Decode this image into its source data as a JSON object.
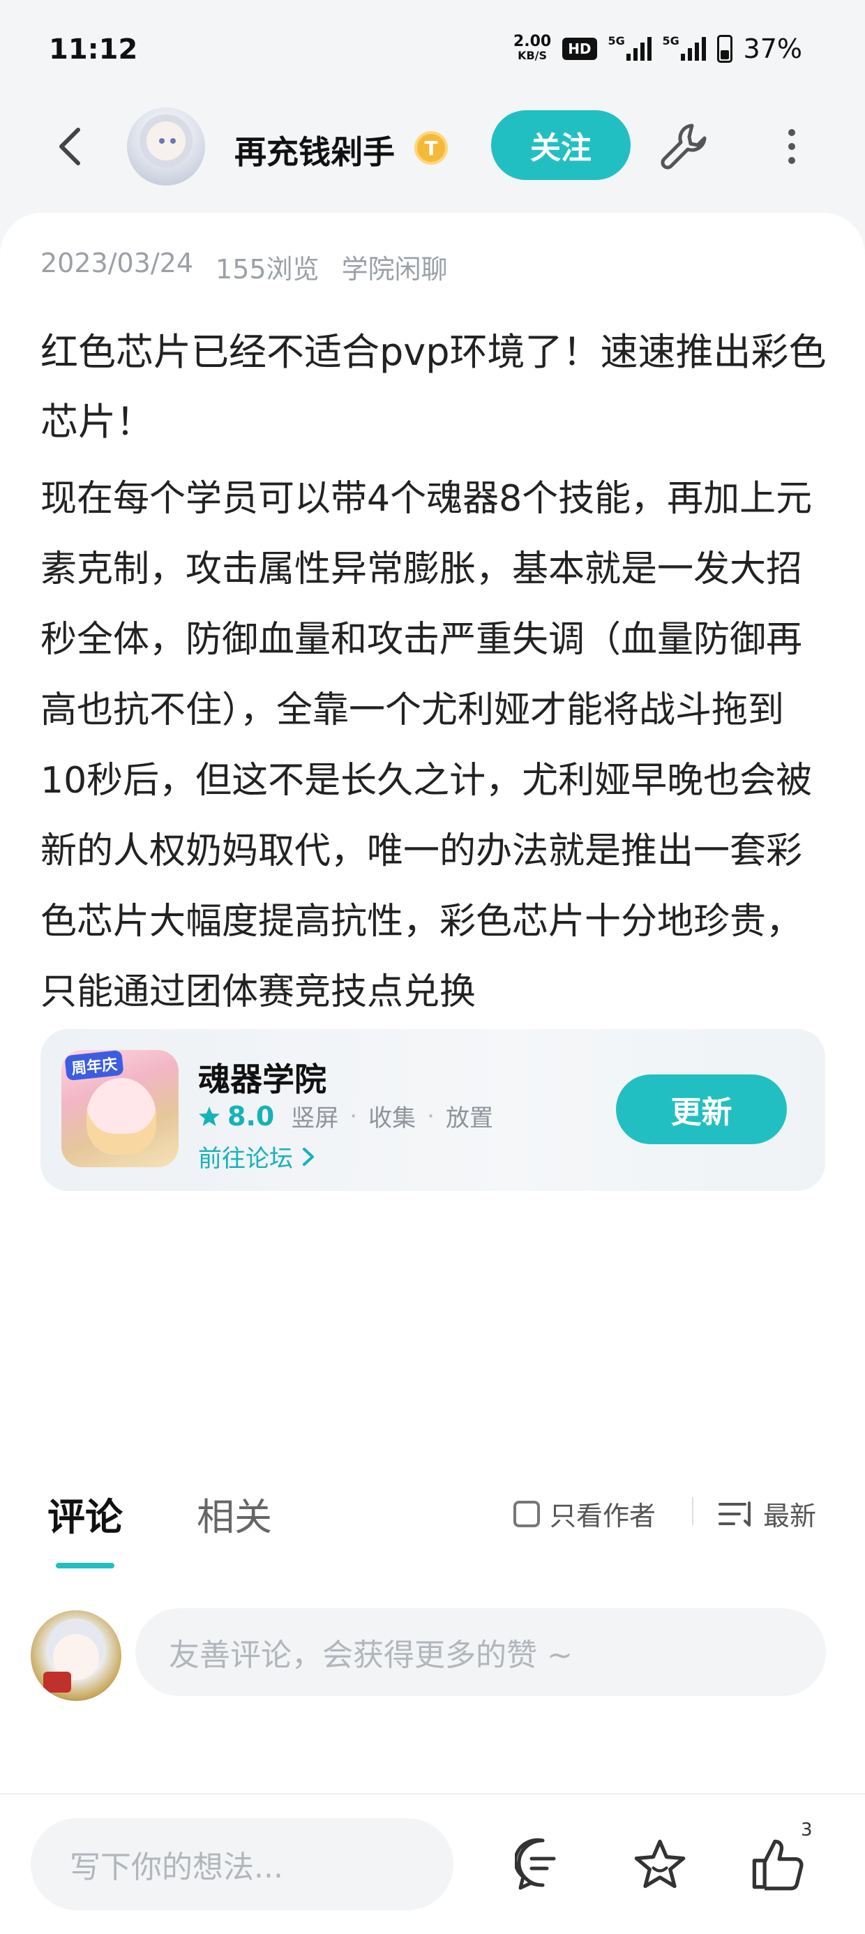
{
  "status_bar": {
    "time": "11:12",
    "net_speed_value": "2.00",
    "net_speed_unit": "KB/S",
    "hd_label": "HD",
    "signal1_tag": "5G",
    "signal2_tag": "5G",
    "battery": "37%"
  },
  "header": {
    "author_name": "再充钱剁手",
    "badge_letter": "T",
    "follow_label": "关注"
  },
  "post": {
    "date": "2023/03/24",
    "views": "155浏览",
    "category": "学院闲聊",
    "title": "红色芯片已经不适合pvp环境了！速速推出彩色芯片！",
    "body": "现在每个学员可以带4个魂器8个技能，再加上元素克制，攻击属性异常膨胀，基本就是一发大招秒全体，防御血量和攻击严重失调（血量防御再高也抗不住），全靠一个尤利娅才能将战斗拖到10秒后，但这不是长久之计，尤利娅早晚也会被新的人权奶妈取代，唯一的办法就是推出一套彩色芯片大幅度提高抗性，彩色芯片十分地珍贵，只能通过团体赛竞技点兑换",
    "like_count": "3"
  },
  "app_card": {
    "icon_tag": "周年庆",
    "name": "魂器学院",
    "rating": "8.0",
    "tags": [
      "竖屏",
      "收集",
      "放置"
    ],
    "forum_link": "前往论坛",
    "update_label": "更新"
  },
  "comments": {
    "tab_comment": "评论",
    "tab_related": "相关",
    "author_only_label": "只看作者",
    "sort_label": "最新",
    "input_placeholder": "友善评论，会获得更多的赞 ~"
  },
  "bottom_bar": {
    "input_placeholder": "写下你的想法...",
    "like_count": "3"
  },
  "colors": {
    "accent": "#22bfc2",
    "accent_text": "#14b3b8",
    "qq_blue": "#1da1f2"
  },
  "icons": [
    "back-icon",
    "wrench-icon",
    "more-vertical-icon",
    "thumbs-up-icon",
    "star-icon",
    "qq-icon",
    "chevron-right-icon",
    "checkbox-icon",
    "sort-icon",
    "comment-icon"
  ]
}
